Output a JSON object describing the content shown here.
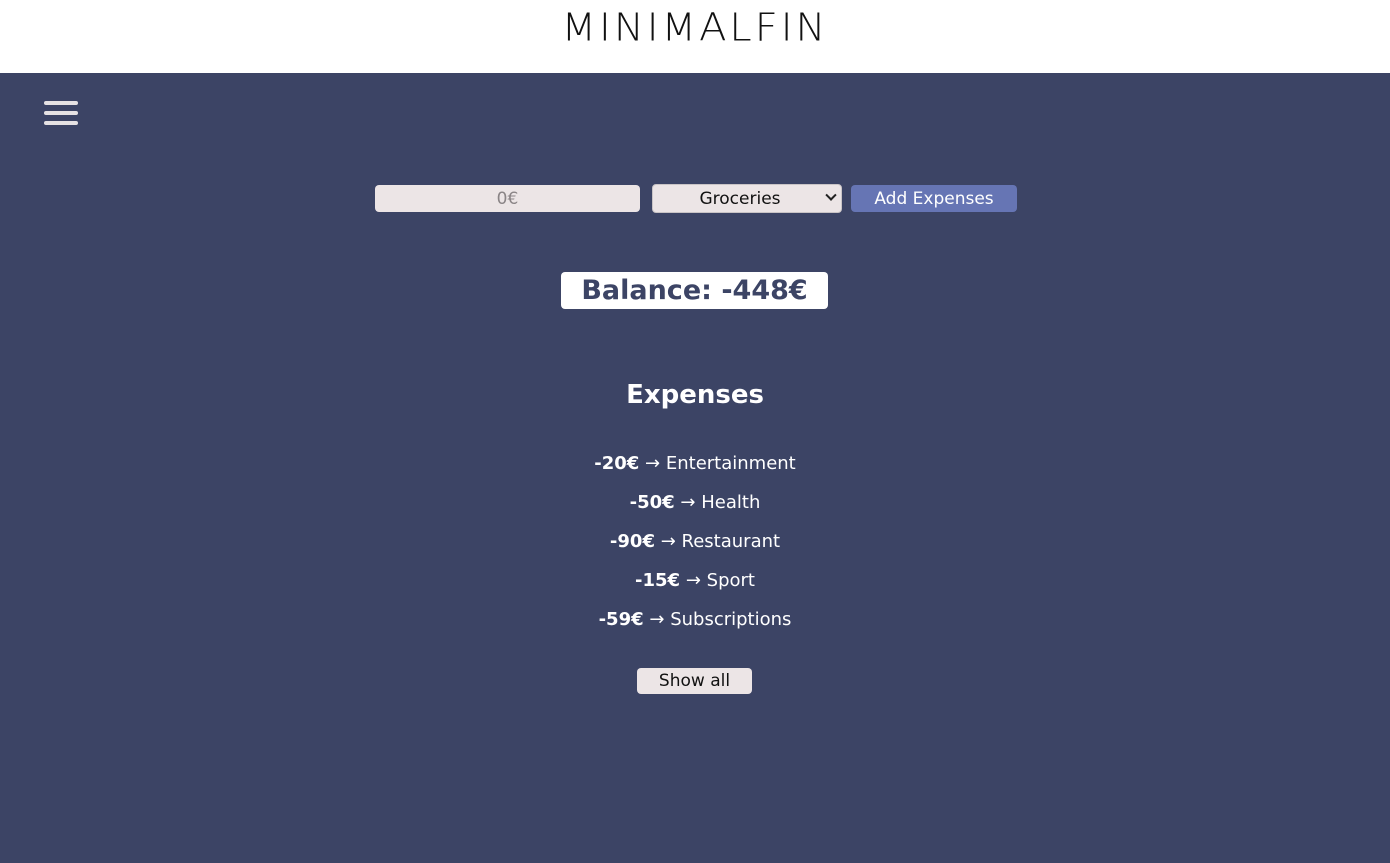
{
  "app": {
    "logo_text": "MINIMALFIN"
  },
  "header": {
    "menu_icon": "hamburger-menu-icon"
  },
  "form": {
    "amount_placeholder": "0€",
    "amount_value": "",
    "category_selected": "Groceries",
    "add_button_label": "Add Expenses"
  },
  "balance": {
    "text": "Balance: -448€"
  },
  "expenses": {
    "title": "Expenses",
    "arrow": "→",
    "items": [
      {
        "amount": "-20€",
        "category": "Entertainment"
      },
      {
        "amount": "-50€",
        "category": "Health"
      },
      {
        "amount": "-90€",
        "category": "Restaurant"
      },
      {
        "amount": "-15€",
        "category": "Sport"
      },
      {
        "amount": "-59€",
        "category": "Subscriptions"
      }
    ],
    "show_all_label": "Show all"
  },
  "colors": {
    "background": "#3c4465",
    "header_bg": "#ffffff",
    "accent_button": "#6675b4",
    "light_field": "#ece5e6"
  }
}
